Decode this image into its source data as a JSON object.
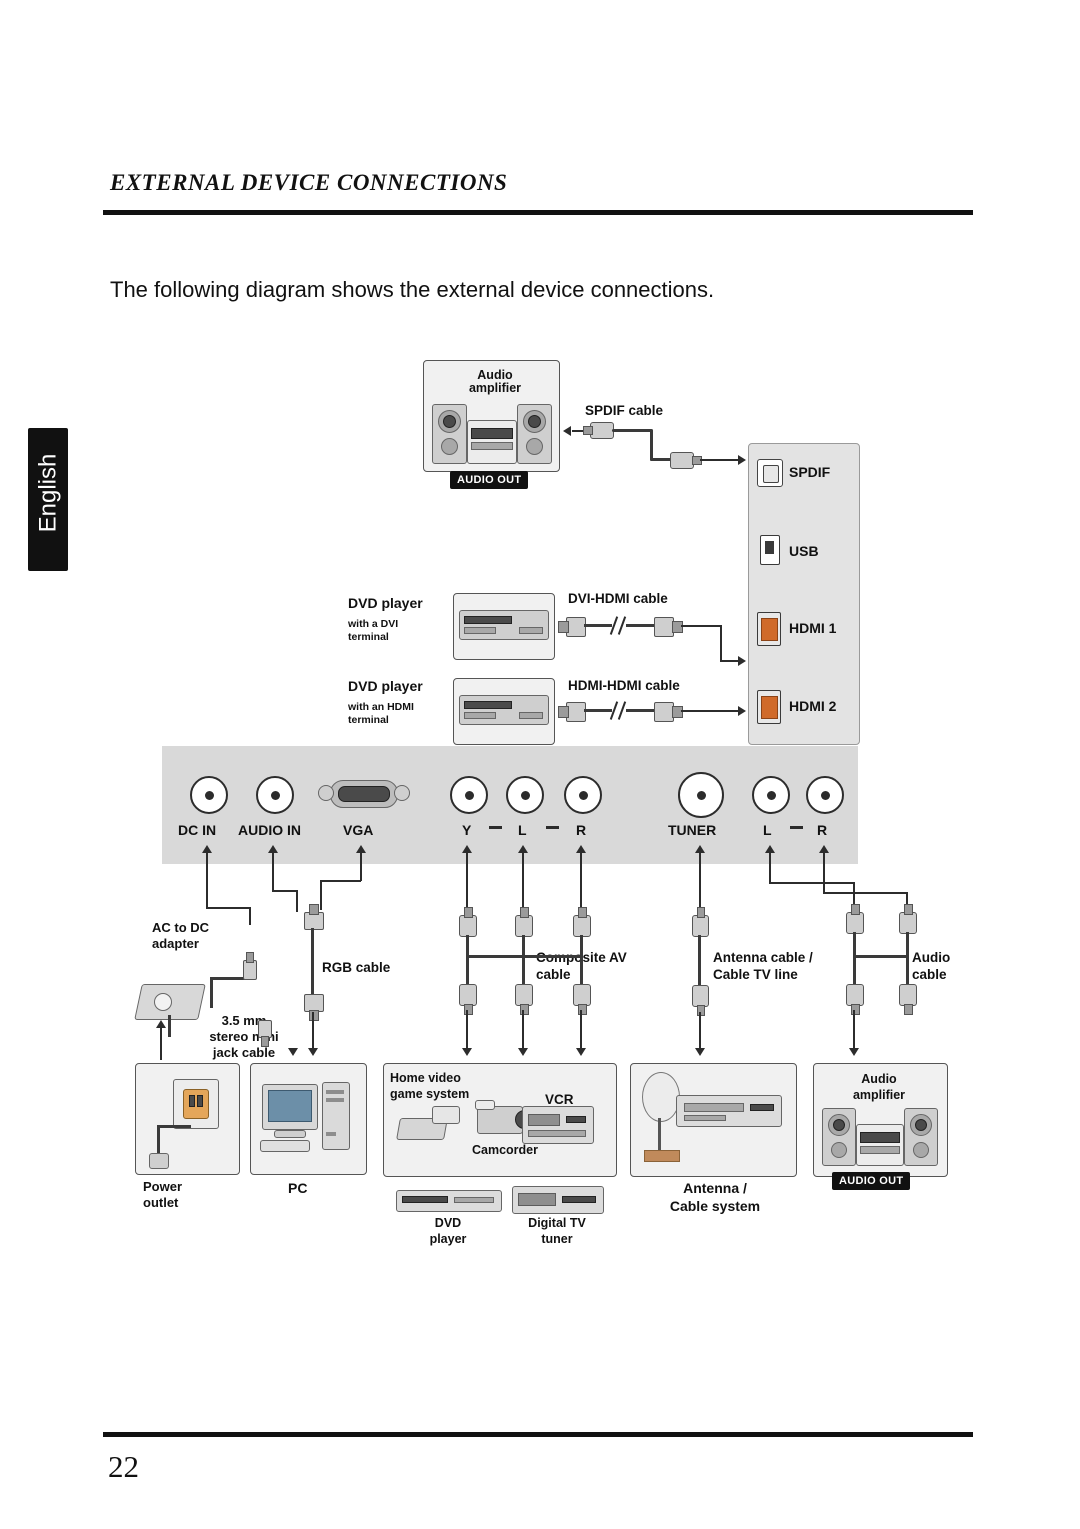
{
  "header": {
    "chapter_title": "EXTERNAL DEVICE CONNECTIONS",
    "intro": "The following diagram shows the external device connections."
  },
  "side_tab": {
    "label": "English"
  },
  "footer": {
    "page_number": "22"
  },
  "diagram": {
    "top_devices": {
      "audio_amplifier": {
        "line1": "Audio",
        "line2": "amplifier",
        "chip": "AUDIO OUT"
      },
      "spdif_cable": "SPDIF cable",
      "dvd_dvi": {
        "title": "DVD player",
        "sub1": "with a DVI",
        "sub2": "terminal",
        "cable": "DVI-HDMI cable"
      },
      "dvd_hdmi": {
        "title": "DVD player",
        "sub1": "with an HDMI",
        "sub2": "terminal",
        "cable": "HDMI-HDMI cable"
      }
    },
    "tv_ports_right": [
      {
        "name": "SPDIF",
        "icon": "spdif-port-icon"
      },
      {
        "name": "USB",
        "icon": "usb-port-icon"
      },
      {
        "name": "HDMI 1",
        "icon": "hdmi-port-icon"
      },
      {
        "name": "HDMI 2",
        "icon": "hdmi-port-icon"
      }
    ],
    "panel_labels": [
      "DC IN",
      "AUDIO IN",
      "VGA",
      "Y",
      "L",
      "R",
      "TUNER",
      "L",
      "R"
    ],
    "bottom_left": {
      "ac_adapter": {
        "line1": "AC to DC",
        "line2": "adapter"
      },
      "mini_jack": {
        "line1": "3.5 mm",
        "line2": "stereo mini",
        "line3": "jack cable"
      },
      "rgb_cable": "RGB cable",
      "power_outlet": {
        "line1": "Power",
        "line2": "outlet"
      },
      "pc": "PC"
    },
    "bottom_middle": {
      "composite_cable": {
        "line1": "Composite AV",
        "line2": "cable"
      },
      "home_video": {
        "line1": "Home video",
        "line2": "game system"
      },
      "vcr": "VCR",
      "camcorder": "Camcorder",
      "dvd_player": {
        "line1": "DVD",
        "line2": "player"
      },
      "digital_tv_tuner": {
        "line1": "Digital TV",
        "line2": "tuner"
      }
    },
    "bottom_right": {
      "antenna_cable": {
        "line1": "Antenna cable /",
        "line2": "Cable TV line"
      },
      "antenna_system": {
        "line1": "Antenna /",
        "line2": "Cable system"
      },
      "audio_cable": {
        "line1": "Audio",
        "line2": "cable"
      },
      "audio_amplifier": {
        "line1": "Audio",
        "line2": "amplifier",
        "chip": "AUDIO OUT"
      }
    }
  },
  "colors": {
    "rule": "#111111",
    "panel": "#d9d9d9",
    "box_fill": "#f1f1f1",
    "box_stroke": "#555555",
    "chip_bg": "#111111"
  }
}
